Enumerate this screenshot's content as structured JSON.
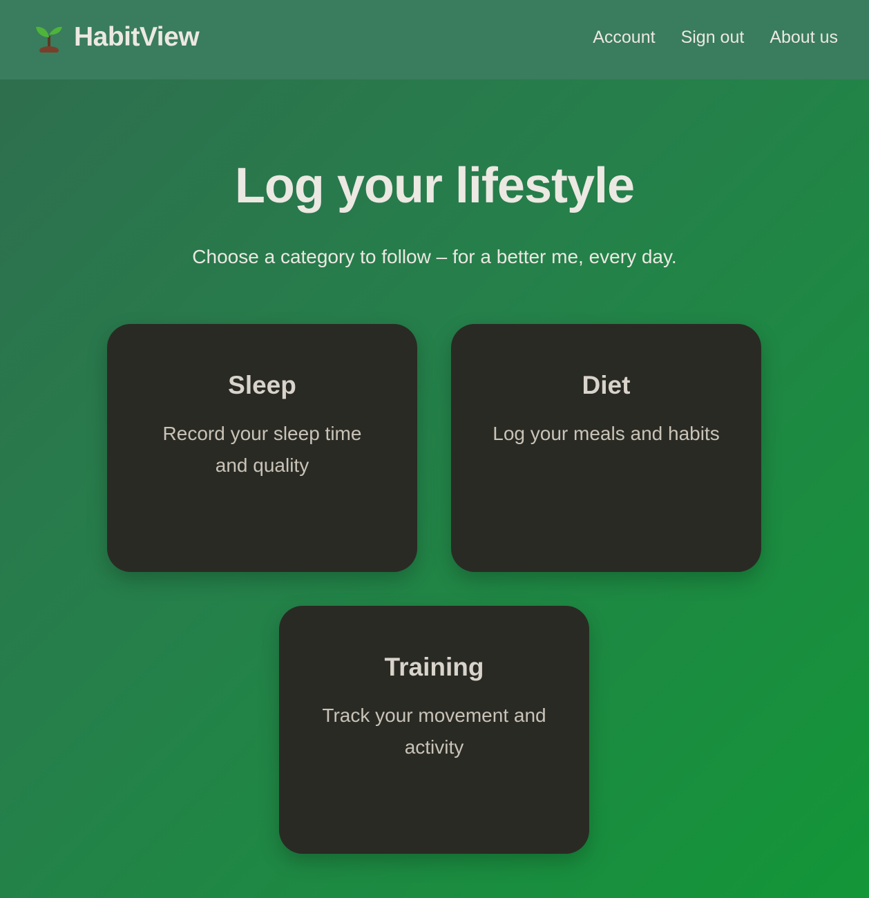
{
  "header": {
    "brand_name": "HabitView",
    "logo_icon": "sprout-icon",
    "nav": {
      "account": "Account",
      "sign_out": "Sign out",
      "about_us": "About us"
    }
  },
  "main": {
    "headline": "Log your lifestyle",
    "subtitle": "Choose a category to follow – for a better me, every day.",
    "categories": [
      {
        "title": "Sleep",
        "description": "Record your sleep time and quality"
      },
      {
        "title": "Diet",
        "description": "Log your meals and habits"
      },
      {
        "title": "Training",
        "description": "Track your movement and activity"
      }
    ]
  },
  "colors": {
    "header_bg": "#3a7c5e",
    "card_bg": "#2a2a24",
    "text_light": "#ece8e2",
    "sprout_green": "#4fb43a",
    "soil_brown": "#7a3f2a"
  }
}
